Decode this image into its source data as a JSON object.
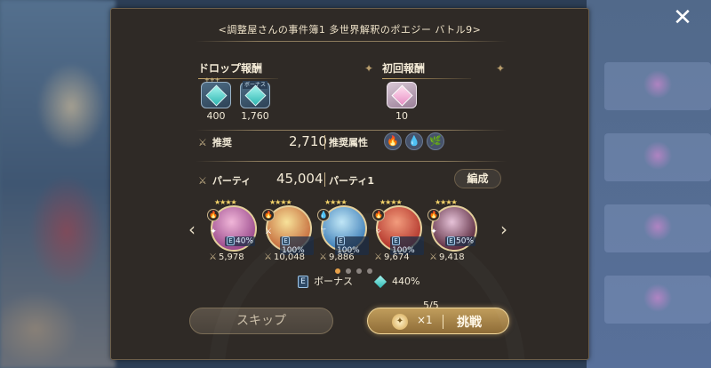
{
  "window": {
    "close_icon": "close-x-icon"
  },
  "title": "<調整屋さんの事件簿1 多世界解釈のポエジー バトル9>",
  "drop_rewards": {
    "label": "ドロップ報酬",
    "items": [
      {
        "icon": "crystal-icon",
        "tag": "+++",
        "quantity": "400"
      },
      {
        "icon": "crystal-icon",
        "tag": "ボーナス",
        "quantity": "1,760"
      }
    ]
  },
  "first_rewards": {
    "label": "初回報酬",
    "items": [
      {
        "icon": "pink-crystal-icon",
        "quantity": "10"
      }
    ]
  },
  "recommend": {
    "label": "推奨",
    "power": "2,710",
    "attr_label": "推奨属性",
    "attributes": [
      {
        "name": "fire",
        "glyph": "🔥",
        "color": "#d94a3a"
      },
      {
        "name": "water",
        "glyph": "💧",
        "color": "#4a9be0"
      },
      {
        "name": "wood",
        "glyph": "🌿",
        "color": "#5bbf6a"
      }
    ]
  },
  "party": {
    "label": "パーティ",
    "power": "45,004",
    "name": "パーティ1",
    "edit_label": "編成",
    "members": [
      {
        "stars": "★★★★",
        "element": "🔥",
        "class_glyph": "✦",
        "bonus": "40%",
        "power": "5,978",
        "color1": "#f0b6d8",
        "color2": "#9a4a8c"
      },
      {
        "stars": "★★★★",
        "element": "🔥",
        "class_glyph": "⚔",
        "bonus": "100%",
        "power": "10,048",
        "color1": "#f7e29a",
        "color2": "#c46a3a"
      },
      {
        "stars": "★★★★",
        "element": "💧",
        "class_glyph": "⚚",
        "bonus": "100%",
        "power": "9,886",
        "color1": "#bfe6f6",
        "color2": "#3f7fb8"
      },
      {
        "stars": "★★★★",
        "element": "🔥",
        "class_glyph": "✧",
        "bonus": "100%",
        "power": "9,674",
        "color1": "#f29a7a",
        "color2": "#b2342a"
      },
      {
        "stars": "★★★★",
        "element": "🔥",
        "class_glyph": "✦",
        "bonus": "50%",
        "power": "9,418",
        "color1": "#e6c2d8",
        "color2": "#5a2a3e"
      }
    ],
    "page_dots": 4,
    "active_dot": 0
  },
  "bonus": {
    "e_label": "E",
    "label": "ボーナス",
    "value": "440%"
  },
  "buttons": {
    "skip": "スキップ",
    "challenge_multiplier": "×1",
    "challenge": "挑戦",
    "tickets": "5/5"
  }
}
